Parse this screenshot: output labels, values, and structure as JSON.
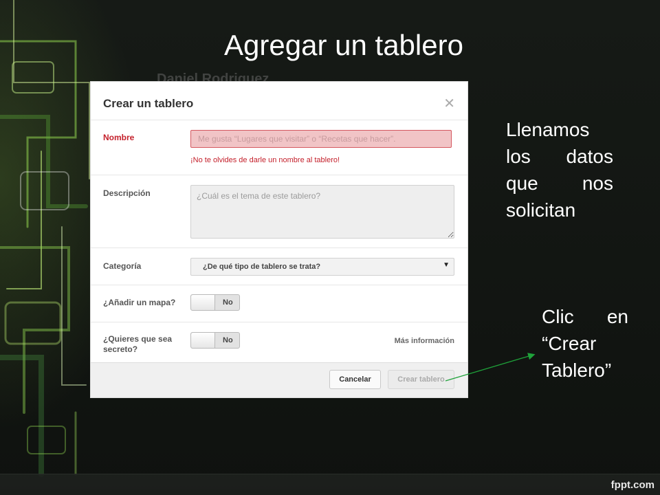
{
  "slide": {
    "title": "Agregar un tablero",
    "footer_brand": "fppt.com",
    "background_behind_dialog": "Daniel Rodriguez"
  },
  "dialog": {
    "title": "Crear un tablero",
    "close_icon": "close-icon",
    "name": {
      "label": "Nombre",
      "placeholder": "Me gusta “Lugares que visitar” o “Recetas que hacer”.",
      "error": "¡No te olvides de darle un nombre al tablero!"
    },
    "description": {
      "label": "Descripción",
      "placeholder": "¿Cuál es el tema de este tablero?"
    },
    "category": {
      "label": "Categoría",
      "selected": "¿De qué tipo de tablero se trata?"
    },
    "map": {
      "label": "¿Añadir un mapa?",
      "toggle_value": "No"
    },
    "secret": {
      "label_line1": "¿Quieres que sea",
      "label_line2": "secreto?",
      "toggle_value": "No",
      "more_info": "Más información"
    },
    "buttons": {
      "cancel": "Cancelar",
      "create": "Crear tablero"
    }
  },
  "notes": {
    "fill_data": [
      "Llenamos",
      "los datos",
      "que nos",
      "solicitan"
    ],
    "click_create": [
      "Clic en",
      "“Crear",
      "Tablero”"
    ]
  },
  "colors": {
    "error_red": "#c4202b",
    "arrow_green": "#1fa23a"
  }
}
